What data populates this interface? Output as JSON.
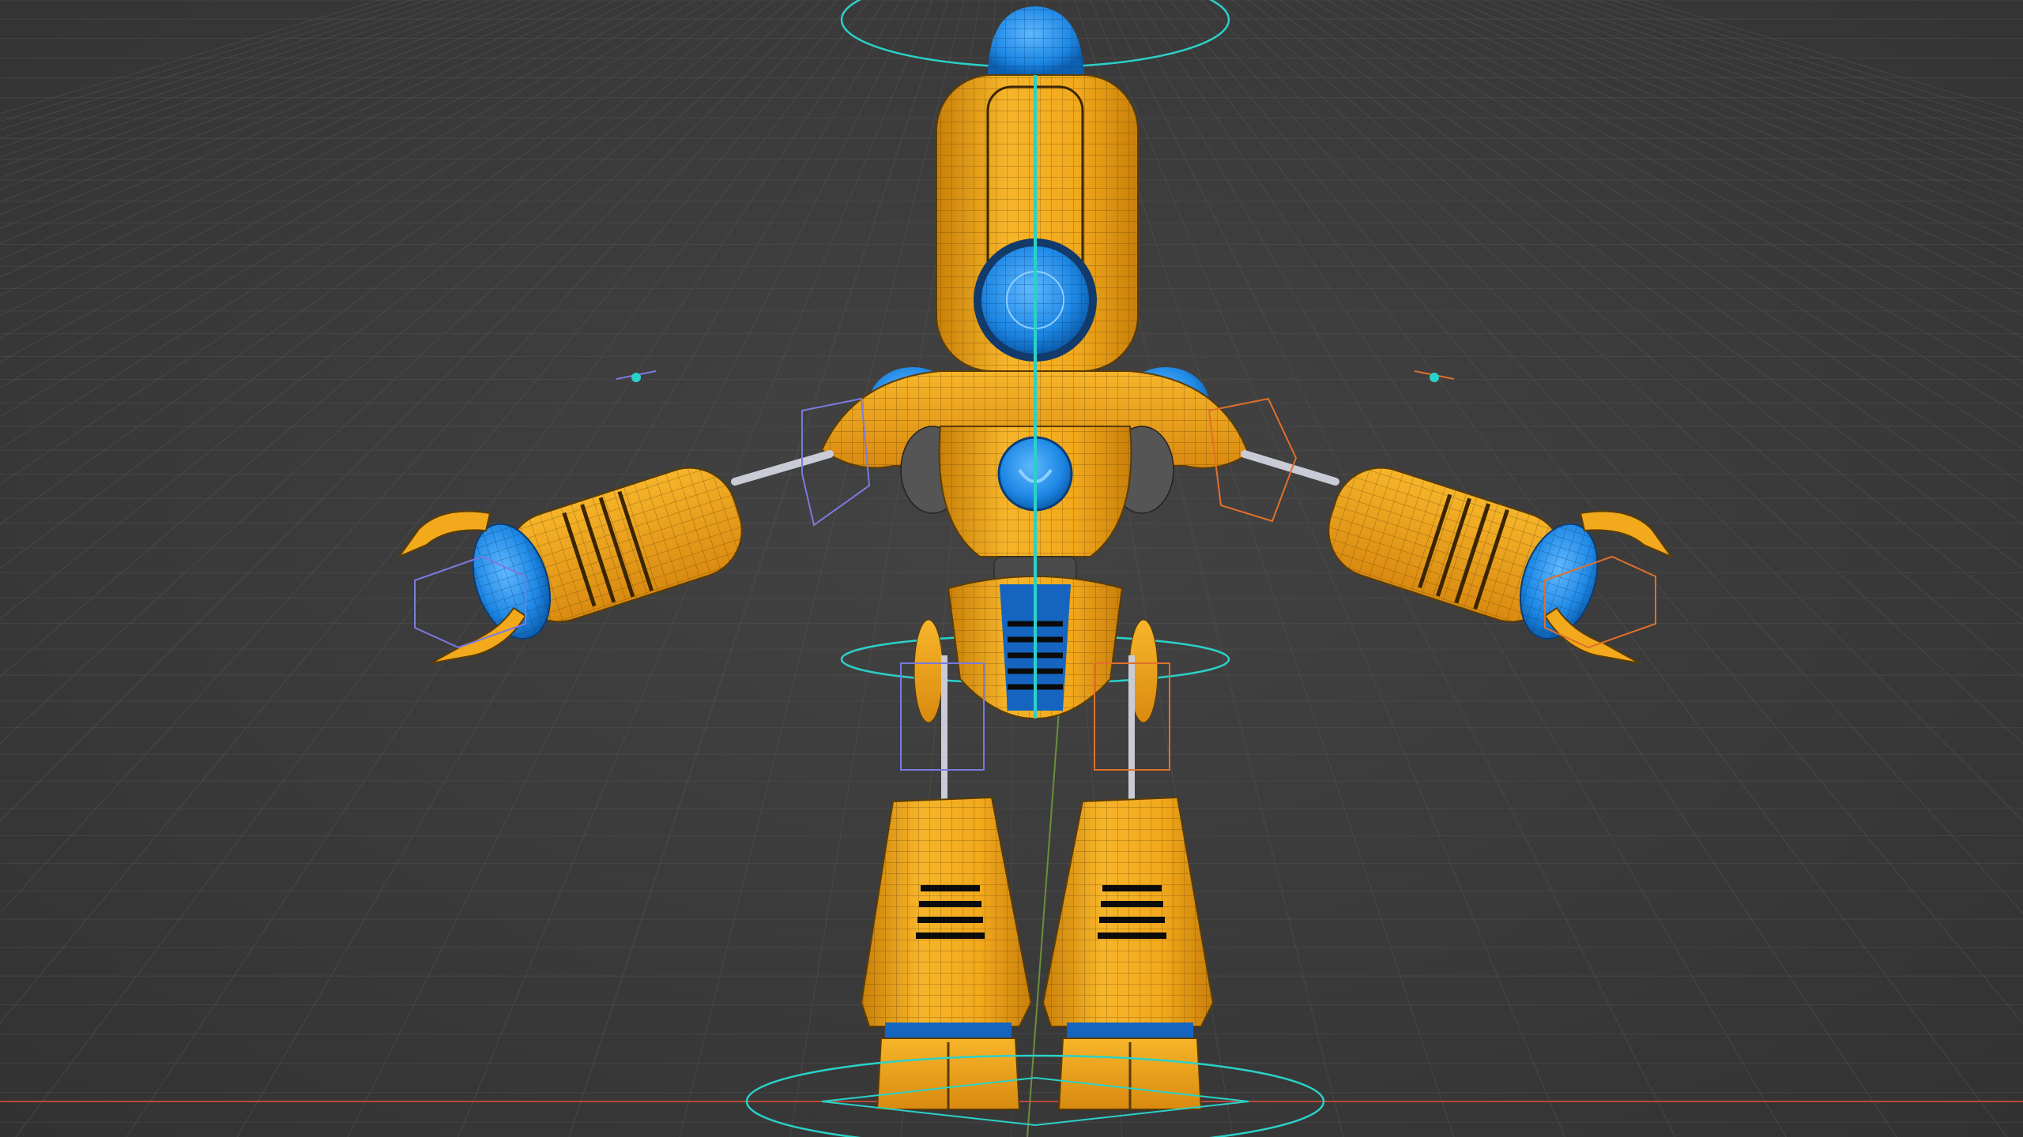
{
  "viewport": {
    "background_color": "#3b3b3b",
    "grid_color": "#555555",
    "x_axis_color": "#b84a3a",
    "y_axis_color": "#6a8f3a"
  },
  "model": {
    "body_color": "#f2a91c",
    "body_shade_color": "#d98a10",
    "accent_color": "#1e88e5",
    "wire_color": "#5a3c08",
    "bone_color": "#c9ccd6",
    "active_bone_color": "#2bd1c8",
    "left_control_color": "#7a7ae0",
    "right_control_color": "#e0702a"
  }
}
